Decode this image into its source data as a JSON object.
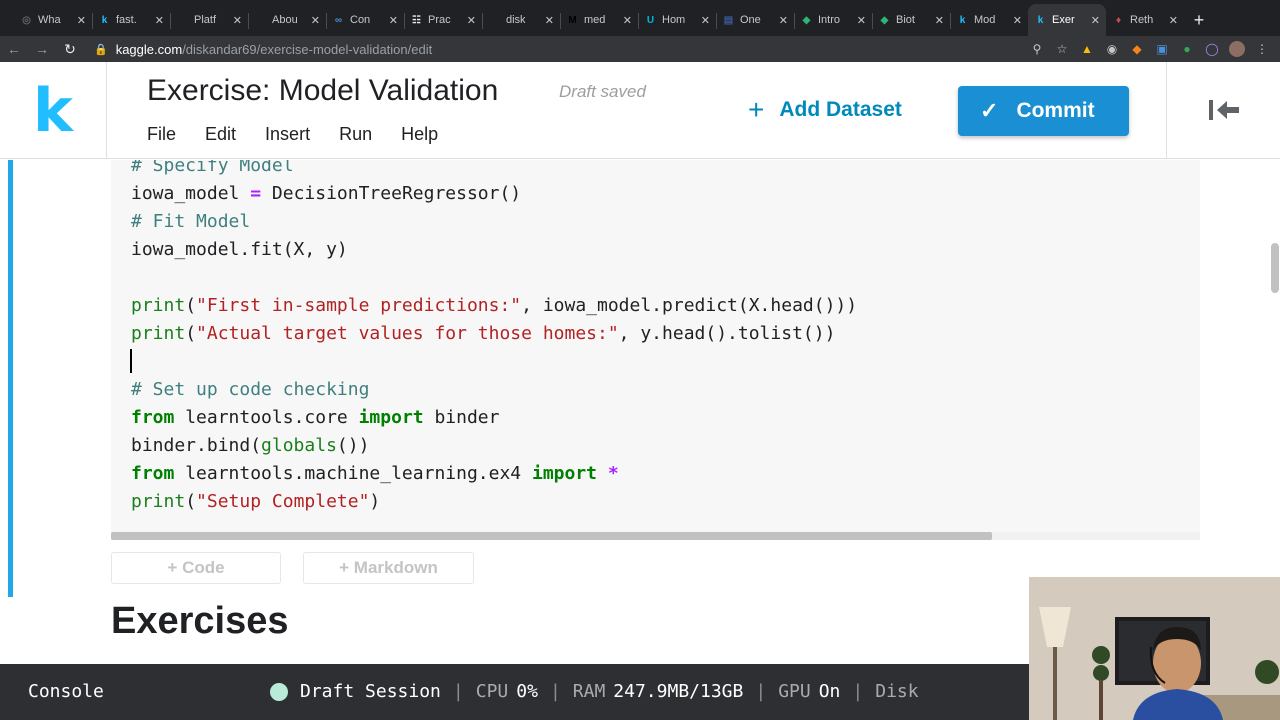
{
  "browser": {
    "tabs": [
      {
        "label": "Wha",
        "icon": "globe-icon",
        "color": "#5f6368"
      },
      {
        "label": "fast.",
        "icon": "kaggle-icon",
        "color": "#20beff"
      },
      {
        "label": "Platf",
        "icon": "github-icon",
        "color": "#202124"
      },
      {
        "label": "Abou",
        "icon": "github-icon",
        "color": "#202124"
      },
      {
        "label": "Con",
        "icon": "infinity-icon",
        "color": "#4a90d9"
      },
      {
        "label": "Prac",
        "icon": "doc-icon",
        "color": "#e8eaed"
      },
      {
        "label": "disk",
        "icon": "github-icon",
        "color": "#202124"
      },
      {
        "label": "med",
        "icon": "medium-icon",
        "color": "#000000"
      },
      {
        "label": "Hom",
        "icon": "udacity-icon",
        "color": "#02b3e4"
      },
      {
        "label": "One",
        "icon": "window-icon",
        "color": "#3b5998"
      },
      {
        "label": "Intro",
        "icon": "shield-icon",
        "color": "#2bb673"
      },
      {
        "label": "Biot",
        "icon": "shield-icon",
        "color": "#2bb673"
      },
      {
        "label": "Mod",
        "icon": "kaggle-icon",
        "color": "#20beff"
      },
      {
        "label": "Exer",
        "icon": "kaggle-icon",
        "color": "#20beff",
        "active": true
      },
      {
        "label": "Reth",
        "icon": "person-icon",
        "color": "#c0504d"
      }
    ],
    "url_domain": "kaggle.com",
    "url_path": "/diskandar69/exercise-model-validation/edit"
  },
  "header": {
    "logo": "k",
    "title": "Exercise: Model Validation",
    "status": "Draft saved",
    "menu": [
      "File",
      "Edit",
      "Insert",
      "Run",
      "Help"
    ],
    "add_dataset": "Add Dataset",
    "commit": "Commit"
  },
  "code_lines": [
    [
      {
        "t": "# Specify Model",
        "c": "cm"
      }
    ],
    [
      {
        "t": "iowa_model ",
        "c": ""
      },
      {
        "t": "=",
        "c": "op"
      },
      {
        "t": " DecisionTreeRegressor()",
        "c": ""
      }
    ],
    [
      {
        "t": "# Fit Model",
        "c": "cm"
      }
    ],
    [
      {
        "t": "iowa_model.fit(X, y)",
        "c": ""
      }
    ],
    [],
    [
      {
        "t": "print",
        "c": "bi"
      },
      {
        "t": "(",
        "c": ""
      },
      {
        "t": "\"First in-sample predictions:\"",
        "c": "str"
      },
      {
        "t": ", iowa_model.predict(X.head()))",
        "c": ""
      }
    ],
    [
      {
        "t": "print",
        "c": "bi"
      },
      {
        "t": "(",
        "c": ""
      },
      {
        "t": "\"Actual target values for those homes:\"",
        "c": "str"
      },
      {
        "t": ", y.head().tolist())",
        "c": ""
      }
    ],
    [],
    [
      {
        "t": "# Set up code checking",
        "c": "cm"
      }
    ],
    [
      {
        "t": "from",
        "c": "kw"
      },
      {
        "t": " learntools.core ",
        "c": ""
      },
      {
        "t": "import",
        "c": "kw"
      },
      {
        "t": " binder",
        "c": ""
      }
    ],
    [
      {
        "t": "binder.bind(",
        "c": ""
      },
      {
        "t": "globals",
        "c": "bi"
      },
      {
        "t": "())",
        "c": ""
      }
    ],
    [
      {
        "t": "from",
        "c": "kw"
      },
      {
        "t": " learntools.machine_learning.ex4 ",
        "c": ""
      },
      {
        "t": "import",
        "c": "kw"
      },
      {
        "t": " ",
        "c": ""
      },
      {
        "t": "*",
        "c": "op"
      }
    ],
    [
      {
        "t": "print",
        "c": "bi"
      },
      {
        "t": "(",
        "c": ""
      },
      {
        "t": "\"Setup Complete\"",
        "c": "str"
      },
      {
        "t": ")",
        "c": ""
      }
    ]
  ],
  "cell_actions": {
    "add_code": "+ Code",
    "add_markdown": "+ Markdown"
  },
  "section_heading": "Exercises",
  "console": {
    "label": "Console",
    "session": "Draft Session",
    "cpu_label": "CPU",
    "cpu_value": "0%",
    "ram_label": "RAM",
    "ram_value": "247.9MB/13GB",
    "gpu_label": "GPU",
    "gpu_value": "On",
    "disk_label": "Disk"
  }
}
